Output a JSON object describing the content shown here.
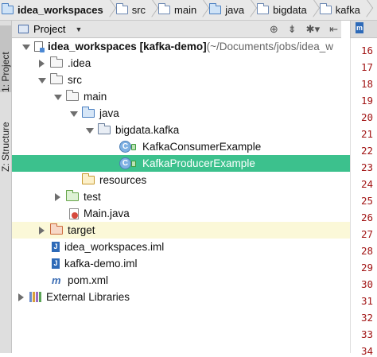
{
  "breadcrumb": {
    "items": [
      "idea_workspaces",
      "src",
      "main",
      "java",
      "bigdata",
      "kafka"
    ]
  },
  "left_tabs": {
    "project": "1: Project",
    "structure": "Z: Structure"
  },
  "panel_header": {
    "title": "Project"
  },
  "tree": {
    "rows": [
      {
        "label": "idea_workspaces [kafka-demo] (~/Documents/jobs/idea_w",
        "bold_part": "idea_workspaces [kafka-demo]",
        "rest": " (~/Documents/jobs/idea_w"
      },
      {
        "label": ".idea"
      },
      {
        "label": "src"
      },
      {
        "label": "main"
      },
      {
        "label": "java"
      },
      {
        "label": "bigdata.kafka"
      },
      {
        "label": "KafkaConsumerExample"
      },
      {
        "label": "KafkaProducerExample"
      },
      {
        "label": "resources"
      },
      {
        "label": "test"
      },
      {
        "label": "Main.java"
      },
      {
        "label": "target"
      },
      {
        "label": "idea_workspaces.iml"
      },
      {
        "label": "kafka-demo.iml"
      },
      {
        "label": "pom.xml"
      },
      {
        "label": "External Libraries"
      }
    ]
  },
  "gutter": {
    "line_numbers": [
      "16",
      "17",
      "18",
      "19",
      "20",
      "21",
      "22",
      "23",
      "24",
      "25",
      "26",
      "27",
      "28",
      "29",
      "30",
      "31",
      "32",
      "33",
      "34"
    ]
  },
  "colors": {
    "selection": "#3cc18d",
    "highlight_row": "#fbf8d8",
    "line_number": "#a21515"
  }
}
